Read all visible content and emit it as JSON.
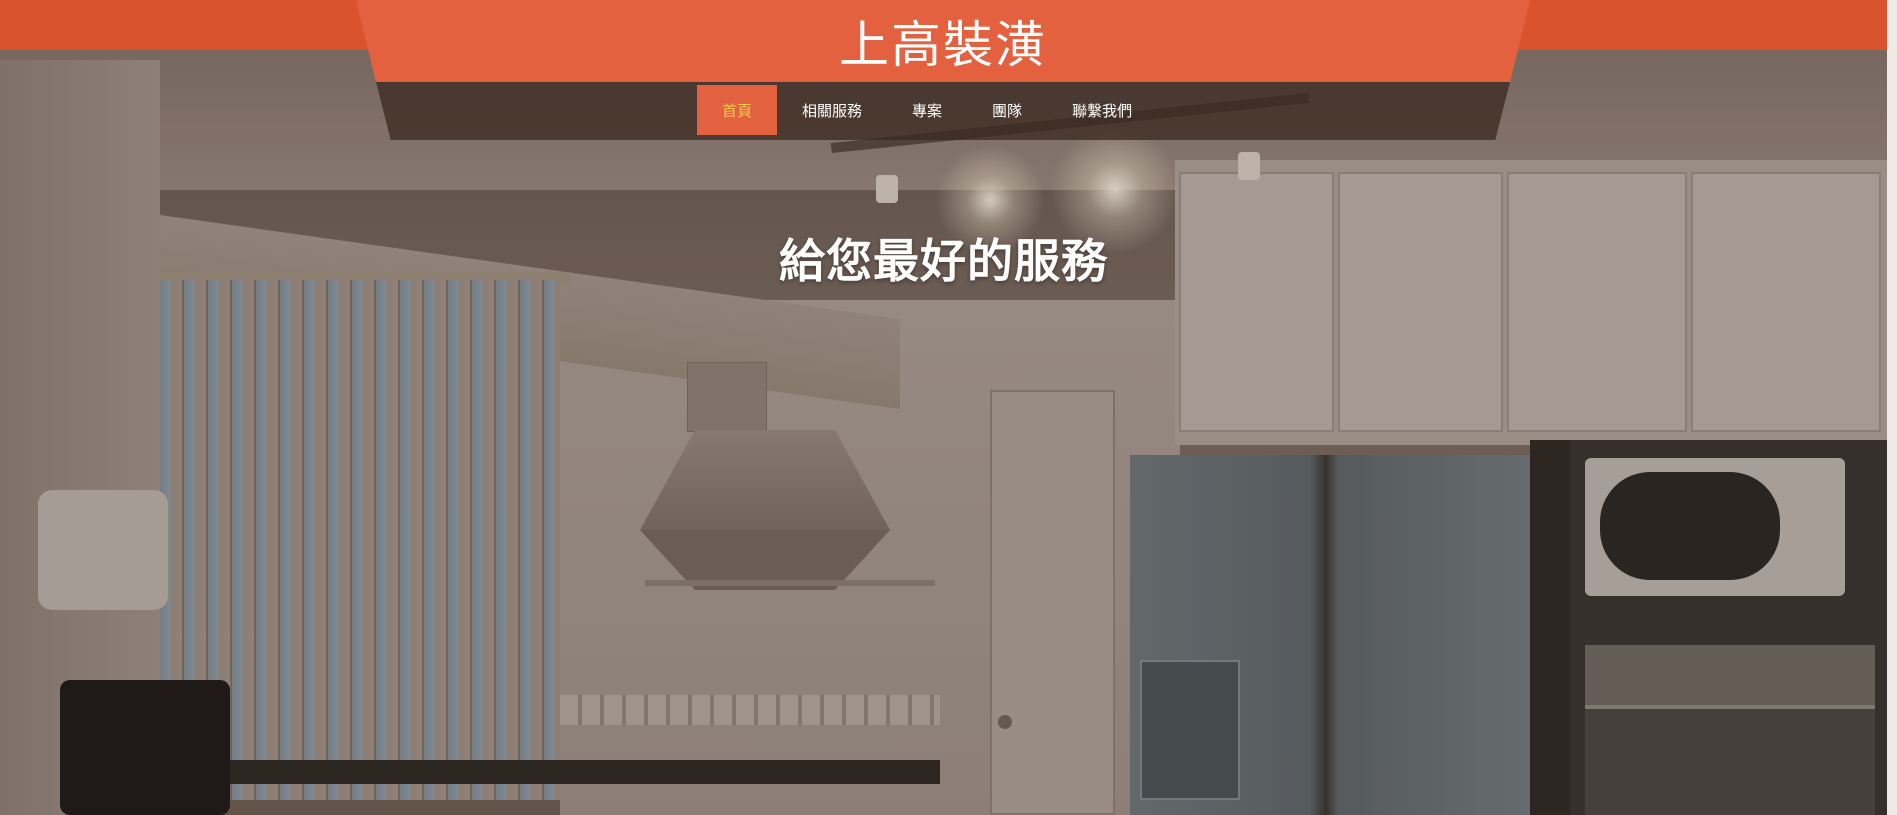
{
  "header": {
    "brand_title": "上高裝潢"
  },
  "nav": {
    "items": [
      {
        "label": "首頁",
        "active": true
      },
      {
        "label": "相關服務",
        "active": false
      },
      {
        "label": "專案",
        "active": false
      },
      {
        "label": "團隊",
        "active": false
      },
      {
        "label": "聯繫我們",
        "active": false
      }
    ]
  },
  "hero": {
    "heading": "給您最好的服務",
    "background_image": "kitchen-photo"
  },
  "colors": {
    "topbar": "#d9532f",
    "brand_plate": "#e4613f",
    "nav_plate": "#3c2a21",
    "active_nav_text": "#f4c94f",
    "text": "#ffffff"
  }
}
